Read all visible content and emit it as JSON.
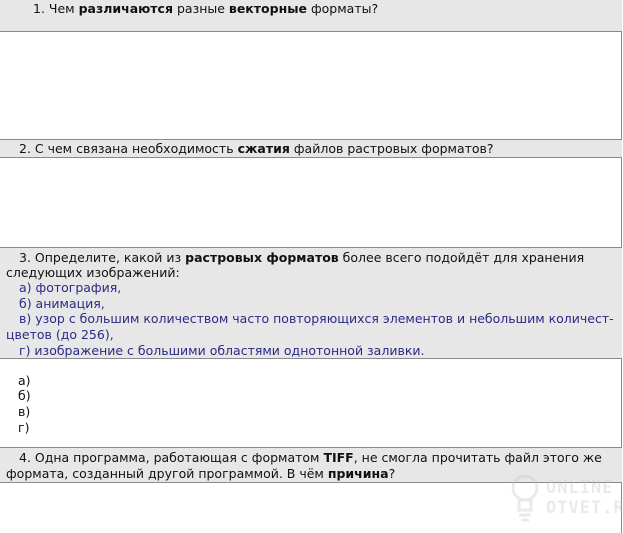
{
  "q1": {
    "pre": "1. Чем ",
    "b1": "различаются",
    "mid": " разные ",
    "b2": "векторные",
    "post": " форматы?"
  },
  "q2": {
    "pre": "2. С чем связана необходимость ",
    "b1": "сжатия",
    "post": " файлов растровых форматов?"
  },
  "q3": {
    "pre": "3. Определите, какой из ",
    "b1": "растровых форматов",
    "post": " более всего подойдёт для хранения",
    "line2": "следующих изображений:",
    "items": [
      "а) фотография,",
      "б) анимация,",
      "в) узор с большим количеством часто повторяющихся элементов и небольшим количест-",
      "цветов (до 256),",
      "г) изображение с большими областями однотонной заливки."
    ]
  },
  "answers3": [
    "а)",
    "б)",
    "в)",
    "г)"
  ],
  "q4": {
    "pre": "4. Одна программа, работающая с форматом ",
    "b1": "TIFF",
    "post": ", не смогла прочитать файл этого же",
    "line2_pre": "формата, созданный другой программой. В чём ",
    "b2": "причина",
    "line2_post": "?"
  },
  "watermark": {
    "line1": "ONLINE",
    "line2": "OTVET.RU",
    "icon": "lightbulb-icon"
  }
}
